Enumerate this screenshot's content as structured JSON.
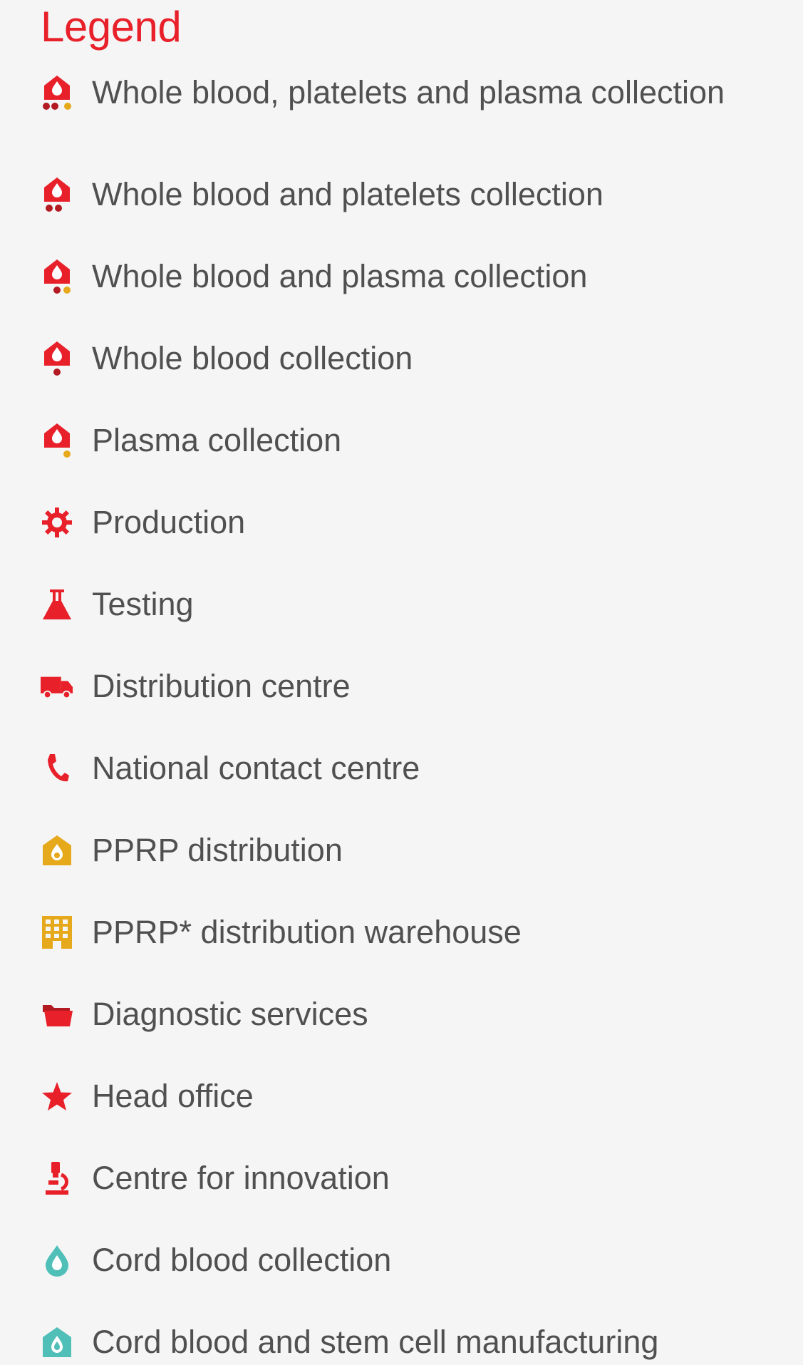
{
  "title": "Legend",
  "colors": {
    "red": "#e8202a",
    "dark_red": "#b31a22",
    "amber": "#e6a91b",
    "teal": "#4fbfb8",
    "text": "#505050",
    "background": "#f5f5f5"
  },
  "items": [
    {
      "label": "Whole blood, platelets and plasma collection",
      "icon": "house-drop-icon-platelets-plasma"
    },
    {
      "label": "Whole blood and platelets collection",
      "icon": "house-drop-icon-platelets"
    },
    {
      "label": "Whole blood and plasma collection",
      "icon": "house-drop-icon-plasma"
    },
    {
      "label": "Whole blood collection",
      "icon": "house-drop-icon"
    },
    {
      "label": "Plasma collection",
      "icon": "house-drop-icon-plasma-only"
    },
    {
      "label": "Production",
      "icon": "gear-icon"
    },
    {
      "label": "Testing",
      "icon": "flask-icon"
    },
    {
      "label": "Distribution centre",
      "icon": "truck-icon"
    },
    {
      "label": "National contact centre",
      "icon": "phone-icon"
    },
    {
      "label": "PPRP distribution",
      "icon": "house-drop-amber-icon"
    },
    {
      "label": "PPRP* distribution warehouse",
      "icon": "building-icon"
    },
    {
      "label": "Diagnostic services",
      "icon": "folder-icon"
    },
    {
      "label": "Head office",
      "icon": "star-icon"
    },
    {
      "label": "Centre for innovation",
      "icon": "microscope-icon"
    },
    {
      "label": "Cord blood collection",
      "icon": "drop-teal-icon"
    },
    {
      "label": "Cord blood and stem cell manufacturing",
      "icon": "house-drop-teal-icon"
    }
  ]
}
